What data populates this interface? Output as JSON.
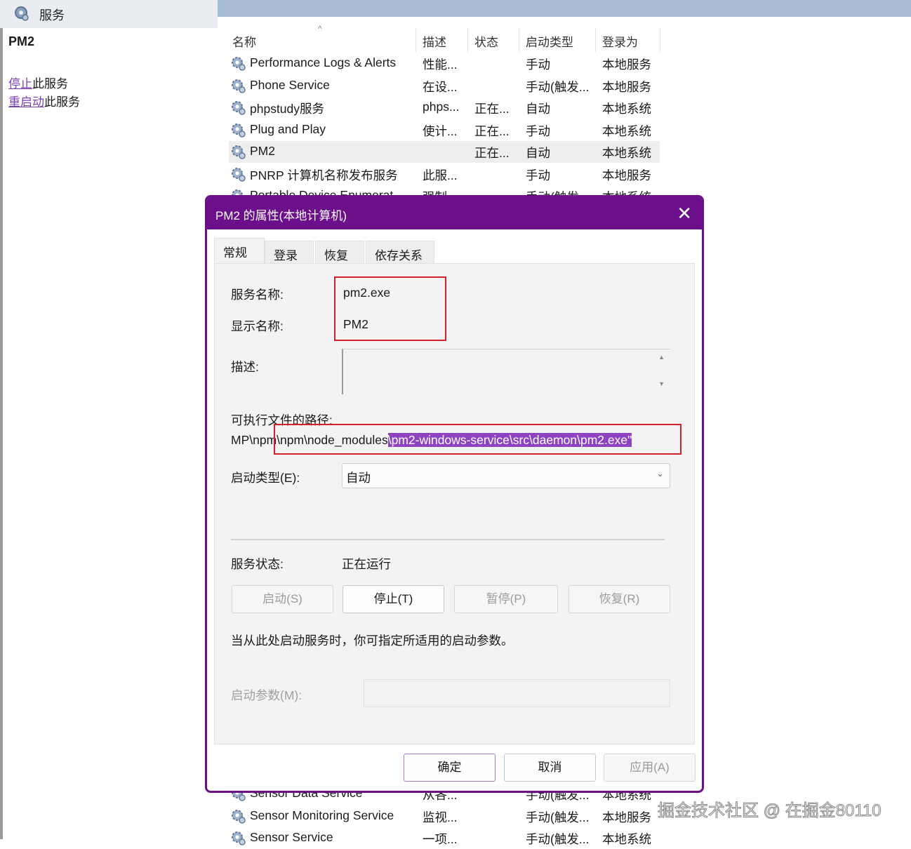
{
  "window": {
    "title": "服务"
  },
  "left_pane": {
    "service_name": "PM2",
    "stop_link": "停止",
    "stop_suffix": "此服务",
    "restart_link": "重启动",
    "restart_suffix": "此服务"
  },
  "list": {
    "headers": [
      "名称",
      "描述",
      "状态",
      "启动类型",
      "登录为"
    ],
    "rows_top": [
      {
        "name": "Performance Logs & Alerts",
        "desc": "性能...",
        "status": "",
        "startup": "手动",
        "logon": "本地服务"
      },
      {
        "name": "Phone Service",
        "desc": "在设...",
        "status": "",
        "startup": "手动(触发...",
        "logon": "本地服务"
      },
      {
        "name": "phpstudy服务",
        "desc": "phps...",
        "status": "正在...",
        "startup": "自动",
        "logon": "本地系统"
      },
      {
        "name": "Plug and Play",
        "desc": "使计...",
        "status": "正在...",
        "startup": "手动",
        "logon": "本地系统"
      },
      {
        "name": "PM2",
        "desc": "",
        "status": "正在...",
        "startup": "自动",
        "logon": "本地系统"
      },
      {
        "name": "PNRP 计算机名称发布服务",
        "desc": "此服...",
        "status": "",
        "startup": "手动",
        "logon": "本地服务"
      },
      {
        "name": "Portable Device Enumerat...",
        "desc": "强制...",
        "status": "",
        "startup": "手动(触发...",
        "logon": "本地系统"
      }
    ],
    "rows_bottom": [
      {
        "name": "Sensor Data Service",
        "desc": "从各...",
        "status": "",
        "startup": "手动(触发...",
        "logon": "本地系统"
      },
      {
        "name": "Sensor Monitoring Service",
        "desc": "监视...",
        "status": "",
        "startup": "手动(触发...",
        "logon": "本地服务"
      },
      {
        "name": "Sensor Service",
        "desc": "一项...",
        "status": "",
        "startup": "手动(触发...",
        "logon": "本地系统"
      }
    ]
  },
  "dialog": {
    "title": "PM2 的属性(本地计算机)",
    "close": "✕",
    "tabs": [
      "常规",
      "登录",
      "恢复",
      "依存关系"
    ],
    "service_name_label": "服务名称:",
    "service_name_value": "pm2.exe",
    "display_name_label": "显示名称:",
    "display_name_value": "PM2",
    "desc_label": "描述:",
    "path_label": "可执行文件的路径:",
    "path_plain": "MP\\npm\\npm\\node_modules",
    "path_selected": "\\pm2-windows-service\\src\\daemon\\pm2.exe\"",
    "startup_type_label": "启动类型(E):",
    "startup_type_value": "自动",
    "status_label": "服务状态:",
    "status_value": "正在运行",
    "btn_start": "启动(S)",
    "btn_stop": "停止(T)",
    "btn_pause": "暂停(P)",
    "btn_resume": "恢复(R)",
    "hint": "当从此处启动服务时，你可指定所适用的启动参数。",
    "params_label": "启动参数(M):",
    "ok": "确定",
    "cancel": "取消",
    "apply": "应用(A)"
  },
  "watermark": "掘金技术社区 @ 在掘金80110",
  "colors": {
    "dialog_accent": "#6b0f8a",
    "highlight_box": "#d0202c",
    "selection": "#8e44c0",
    "link": "#7a3fb0"
  }
}
